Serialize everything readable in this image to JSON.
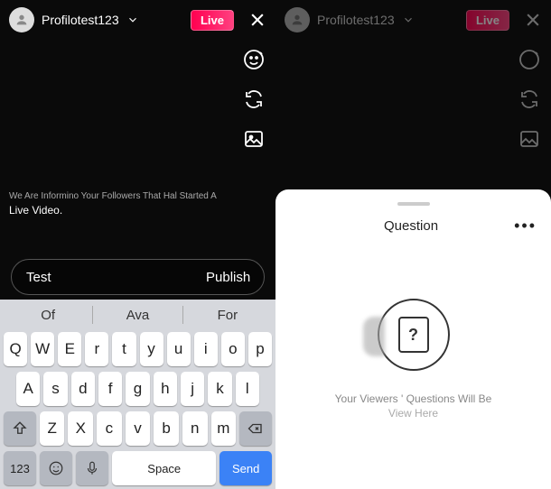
{
  "left": {
    "username": "Profilotest123",
    "live_label": "Live",
    "info_line1": "We Are Informino Your Followers That Hal Started A",
    "info_line2": "Live Video.",
    "comment_value": "Test",
    "publish_label": "Publish"
  },
  "right": {
    "username": "Profilotest123",
    "live_label": "Live",
    "questions_title": "Question",
    "q_mark": "?",
    "q_line1": "Your Viewers ' Questions Will Be",
    "q_line2": "View Here"
  },
  "keyboard": {
    "suggestions": [
      "Of",
      "Ava",
      "For"
    ],
    "row1": [
      "Q",
      "W",
      "E",
      "r",
      "t",
      "y",
      "u",
      "i",
      "o",
      "p"
    ],
    "row2": [
      "A",
      "s",
      "d",
      "f",
      "g",
      "h",
      "j",
      "k",
      "l"
    ],
    "row3": [
      "Z",
      "X",
      "c",
      "v",
      "b",
      "n",
      "m"
    ],
    "mode_key": "123",
    "space_label": "Space",
    "send_label": "Send"
  }
}
